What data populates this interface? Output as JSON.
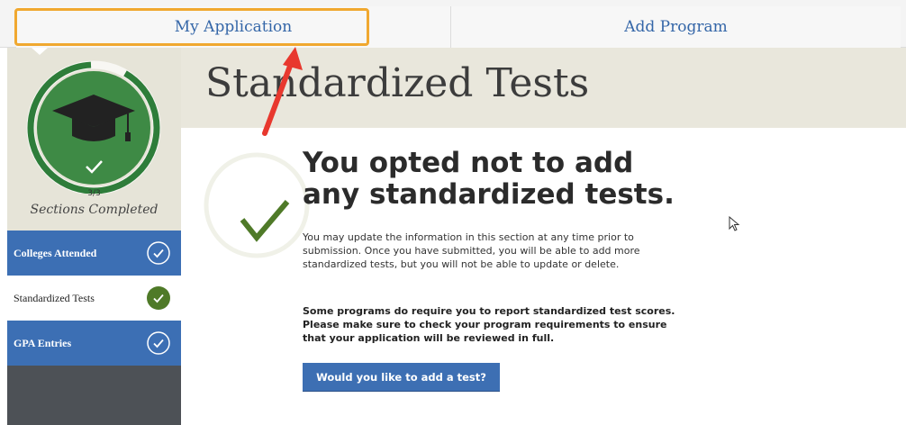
{
  "tabs": {
    "my_application": "My Application",
    "add_program": "Add Program"
  },
  "sidebar": {
    "progress": {
      "completed": 3,
      "total": 3,
      "count_text": "3/3",
      "label": "Sections Completed"
    },
    "items": [
      {
        "label": "Colleges Attended",
        "state": "complete"
      },
      {
        "label": "Standardized Tests",
        "state": "complete-active"
      },
      {
        "label": "GPA Entries",
        "state": "complete"
      }
    ]
  },
  "header": {
    "title": "Standardized Tests"
  },
  "main": {
    "headline": "You opted not to add any standardized tests.",
    "paragraph1": "You may update the information in this section at any time prior to submission. Once you have submitted, you will be able to add more standardized tests, but you will not be able to update or delete.",
    "paragraph2": "Some programs do require you to report standardized test scores. Please make sure to check your program requirements to ensure that your application will be reviewed in full.",
    "add_button": "Would you like to add a test?"
  },
  "colors": {
    "tab_text": "#3466a8",
    "highlight": "#f0a830",
    "nav_blue": "#3c6fb4",
    "progress_green": "#2e7d3a",
    "check_green": "#4f7a28",
    "annotation_arrow": "#e8382e",
    "button_blue": "#3d6fb3"
  },
  "icons": {
    "progress": "graduation-cap-icon",
    "complete": "check-circle-icon",
    "cursor": "mouse-pointer-icon"
  }
}
